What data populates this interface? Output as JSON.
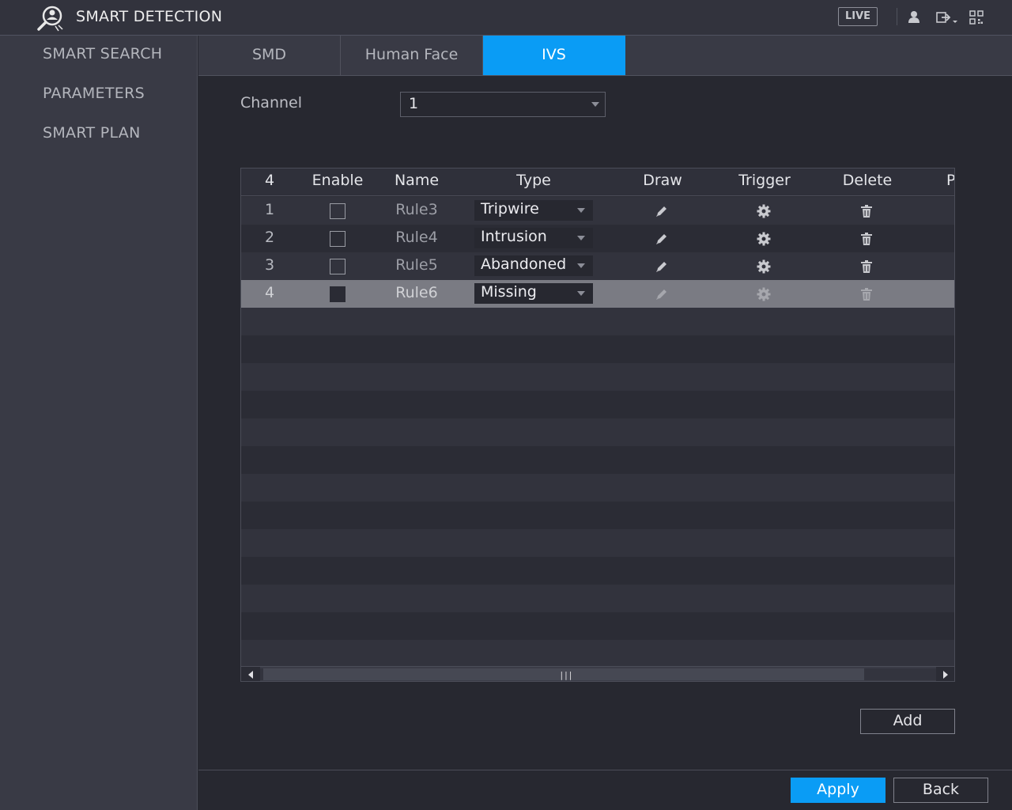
{
  "header": {
    "title": "SMART DETECTION",
    "live_label": "LIVE",
    "icons": [
      "smart-detection-logo-icon",
      "user-icon",
      "logout-icon",
      "qr-code-icon"
    ]
  },
  "sidebar": {
    "items": [
      {
        "label": "SMART SEARCH"
      },
      {
        "label": "PARAMETERS"
      },
      {
        "label": "SMART PLAN"
      }
    ]
  },
  "tabs": [
    {
      "label": "SMD",
      "active": false
    },
    {
      "label": "Human Face",
      "active": false
    },
    {
      "label": "IVS",
      "active": true
    }
  ],
  "channel": {
    "label": "Channel",
    "value": "1"
  },
  "table": {
    "headers": {
      "count": "4",
      "enable": "Enable",
      "name": "Name",
      "type": "Type",
      "draw": "Draw",
      "trigger": "Trigger",
      "delete": "Delete",
      "partial": "P"
    },
    "rows": [
      {
        "num": "1",
        "enabled": false,
        "name": "Rule3",
        "type": "Tripwire",
        "selected": false
      },
      {
        "num": "2",
        "enabled": false,
        "name": "Rule4",
        "type": "Intrusion",
        "selected": false
      },
      {
        "num": "3",
        "enabled": false,
        "name": "Rule5",
        "type": "Abandoned",
        "selected": false
      },
      {
        "num": "4",
        "enabled": false,
        "name": "Rule6",
        "type": "Missing",
        "selected": true
      }
    ],
    "empty_rows": 13
  },
  "buttons": {
    "add": "Add",
    "apply": "Apply",
    "back": "Back"
  },
  "colors": {
    "accent": "#0a9cf5",
    "background": "#272830",
    "sidebar": "#393a45",
    "selected_row": "#7a7b83"
  }
}
